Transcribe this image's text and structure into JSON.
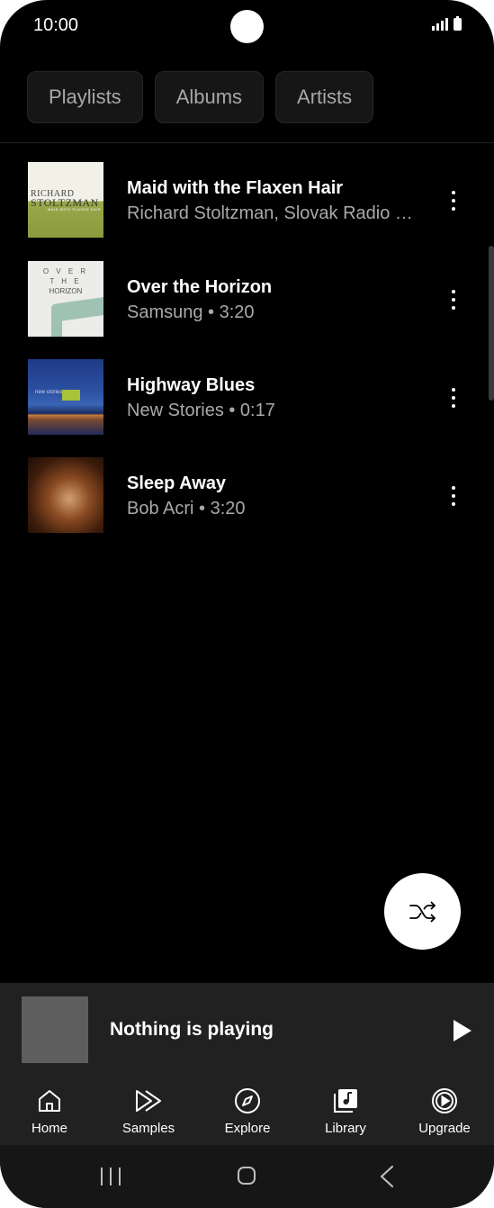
{
  "status_bar": {
    "time": "10:00"
  },
  "tabs": [
    {
      "label": "Playlists"
    },
    {
      "label": "Albums"
    },
    {
      "label": "Artists"
    }
  ],
  "songs": [
    {
      "title": "Maid with the Flaxen Hair",
      "subtitle": "Richard Stoltzman, Slovak Radio Symphony Orchestra",
      "art_line1": "RICHARD",
      "art_line2": "STOLTZMAN",
      "art_line3": "MAID WITH FLAXEN HAIR"
    },
    {
      "title": "Over the Horizon",
      "subtitle": "Samsung • 3:20",
      "art_line1": "O V E R",
      "art_line2": "T H E",
      "art_line3": "HORIZON"
    },
    {
      "title": "Highway Blues",
      "subtitle": "New Stories • 0:17",
      "art_line1": "new stories"
    },
    {
      "title": "Sleep Away",
      "subtitle": "Bob Acri • 3:20"
    }
  ],
  "fab": {
    "icon": "shuffle-icon"
  },
  "mini_player": {
    "title": "Nothing is playing"
  },
  "nav": [
    {
      "label": "Home",
      "icon": "home-icon"
    },
    {
      "label": "Samples",
      "icon": "samples-icon"
    },
    {
      "label": "Explore",
      "icon": "compass-icon"
    },
    {
      "label": "Library",
      "icon": "library-icon"
    },
    {
      "label": "Upgrade",
      "icon": "upgrade-icon"
    }
  ]
}
